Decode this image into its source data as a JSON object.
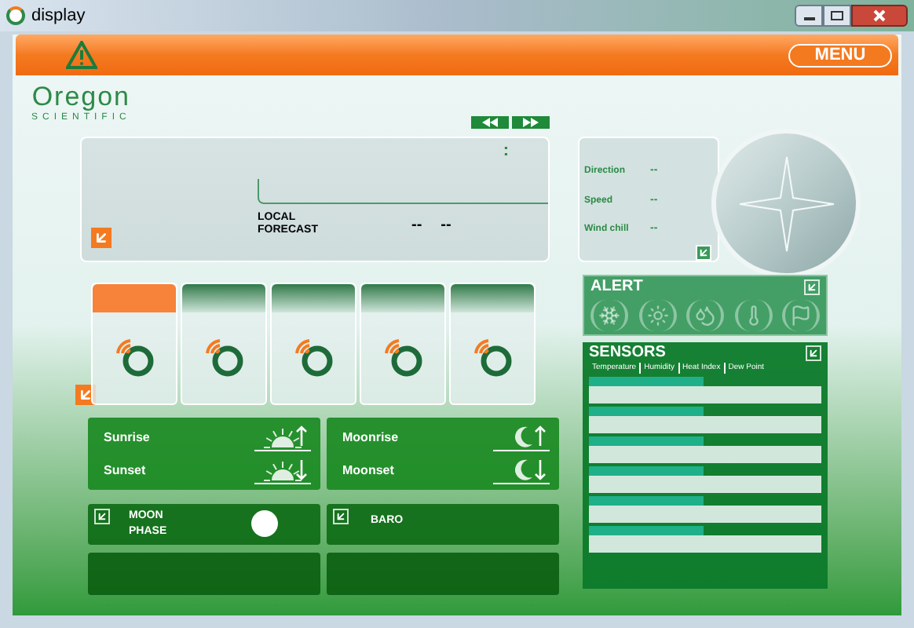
{
  "window": {
    "title": "display"
  },
  "header": {
    "menu_button": "MENU"
  },
  "logo": {
    "name": "Oregon",
    "tagline": "SCIENTIFIC"
  },
  "forecast": {
    "separator": ":",
    "label": "LOCAL FORECAST",
    "values": [
      "--",
      "--"
    ]
  },
  "wind": [
    {
      "label": "Direction",
      "value": "--"
    },
    {
      "label": "Speed",
      "value": "--"
    },
    {
      "label": "Wind chill",
      "value": "--"
    }
  ],
  "days": [
    {
      "selected": true
    },
    {
      "selected": false
    },
    {
      "selected": false
    },
    {
      "selected": false
    },
    {
      "selected": false
    }
  ],
  "sun_moon": [
    {
      "rows": [
        {
          "label": "Sunrise",
          "kind": "sun",
          "rising": true
        },
        {
          "label": "Sunset",
          "kind": "sun",
          "rising": false
        }
      ]
    },
    {
      "rows": [
        {
          "label": "Moonrise",
          "kind": "moon",
          "rising": true
        },
        {
          "label": "Moonset",
          "kind": "moon",
          "rising": false
        }
      ]
    }
  ],
  "moon_phase": {
    "label": "MOON PHASE"
  },
  "baro": {
    "label": "BARO"
  },
  "alert": {
    "title": "ALERT"
  },
  "sensors": {
    "title": "SENSORS",
    "tabs": [
      "Temperature",
      "Humidity",
      "Heat Index",
      "Dew Point"
    ]
  }
}
